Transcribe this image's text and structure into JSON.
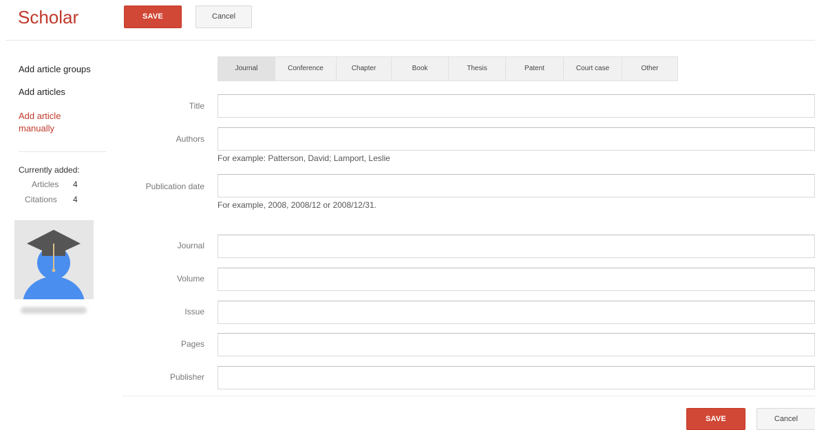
{
  "header": {
    "brand": "Scholar",
    "save_label": "SAVE",
    "cancel_label": "Cancel"
  },
  "sidebar": {
    "items": [
      {
        "label": "Add article groups",
        "active": false
      },
      {
        "label": "Add articles",
        "active": false
      },
      {
        "label": "Add article manually",
        "active": true
      }
    ],
    "currently_added_label": "Currently added:",
    "stats": [
      {
        "label": "Articles",
        "value": "4"
      },
      {
        "label": "Citations",
        "value": "4"
      }
    ],
    "avatar_icon": "graduate-avatar-icon"
  },
  "tabs": [
    {
      "label": "Journal",
      "active": true
    },
    {
      "label": "Conference",
      "active": false
    },
    {
      "label": "Chapter",
      "active": false
    },
    {
      "label": "Book",
      "active": false
    },
    {
      "label": "Thesis",
      "active": false
    },
    {
      "label": "Patent",
      "active": false
    },
    {
      "label": "Court case",
      "active": false
    },
    {
      "label": "Other",
      "active": false
    }
  ],
  "form": {
    "title": {
      "label": "Title",
      "value": ""
    },
    "authors": {
      "label": "Authors",
      "value": "",
      "hint": "For example: Patterson, David; Lamport, Leslie"
    },
    "publication_date": {
      "label": "Publication date",
      "value": "",
      "hint": "For example, 2008, 2008/12 or 2008/12/31."
    },
    "journal": {
      "label": "Journal",
      "value": ""
    },
    "volume": {
      "label": "Volume",
      "value": ""
    },
    "issue": {
      "label": "Issue",
      "value": ""
    },
    "pages": {
      "label": "Pages",
      "value": ""
    },
    "publisher": {
      "label": "Publisher",
      "value": ""
    }
  },
  "footer": {
    "save_label": "SAVE",
    "cancel_label": "Cancel"
  },
  "colors": {
    "brand_red": "#c0392b",
    "save_button": "#d14836",
    "active_link": "#c0392b"
  }
}
